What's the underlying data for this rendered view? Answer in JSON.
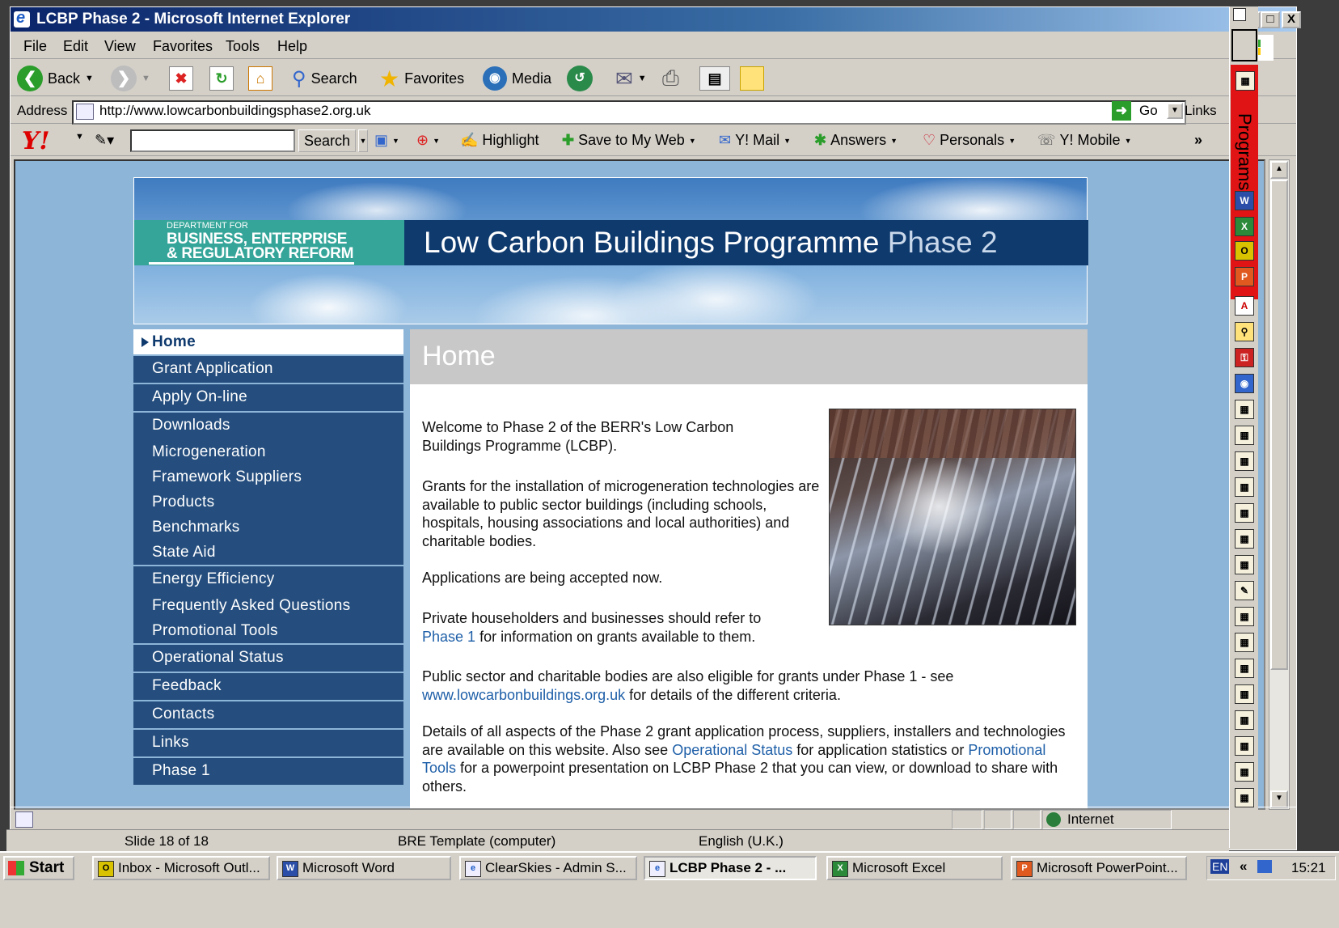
{
  "window": {
    "title": "LCBP Phase 2 - Microsoft Internet Explorer",
    "controls": [
      "_",
      "□",
      "X"
    ]
  },
  "menubar": [
    "File",
    "Edit",
    "View",
    "Favorites",
    "Tools",
    "Help"
  ],
  "toolbar": {
    "back": "Back",
    "search": "Search",
    "favorites": "Favorites",
    "media": "Media"
  },
  "address": {
    "label": "Address",
    "url": "http://www.lowcarbonbuildingsphase2.org.uk",
    "go": "Go",
    "links": "Links"
  },
  "yahoo": {
    "search_button": "Search",
    "highlight": "Highlight",
    "save": "Save to My Web",
    "mail": "Y! Mail",
    "answers": "Answers",
    "personals": "Personals",
    "mobile": "Y! Mobile",
    "more": "»"
  },
  "page": {
    "dept_line1": "DEPARTMENT FOR",
    "dept_line2": "BUSINESS, ENTERPRISE",
    "dept_line3": "& REGULATORY REFORM",
    "title_main": "Low Carbon Buildings Programme",
    "title_phase": "Phase 2",
    "heading": "Home",
    "nav": [
      {
        "label": "Home",
        "active": true
      },
      {
        "label": "Grant Application"
      },
      {
        "label": "Apply On-line"
      },
      {
        "label": "Downloads"
      },
      {
        "label": "Microgeneration"
      },
      {
        "label": "Framework Suppliers"
      },
      {
        "label": "Products"
      },
      {
        "label": "Benchmarks"
      },
      {
        "label": "State Aid"
      },
      {
        "label": "Energy Efficiency"
      },
      {
        "label": "Frequently Asked Questions"
      },
      {
        "label": "Promotional Tools"
      },
      {
        "label": "Operational Status"
      },
      {
        "label": "Feedback"
      },
      {
        "label": "Contacts"
      },
      {
        "label": "Links"
      },
      {
        "label": "Phase 1"
      }
    ],
    "p1": "Welcome to Phase 2 of the BERR's Low Carbon Buildings Programme (LCBP).",
    "p2": "Grants for the installation of microgeneration technologies are available to public sector buildings (including schools, hospitals, housing associations and local authorities) and charitable bodies.",
    "p3": "Applications are being accepted now.",
    "p4_a": "Private householders and businesses should refer to",
    "p4_link": "Phase 1",
    "p4_b": " for information on grants available to them.",
    "p5_a": "Public sector and charitable bodies are also eligible for grants under Phase 1 - see",
    "p5_link": "www.lowcarbonbuildings.org.uk",
    "p5_b": " for details of the different criteria.",
    "p6_a": "Details of all aspects of the Phase 2 grant application process, suppliers, installers and technologies are available on this website. Also see ",
    "p6_link1": "Operational Status",
    "p6_b": " for application statistics or ",
    "p6_link2": "Promotional Tools",
    "p6_c": " for  a powerpoint presentation on LCBP Phase 2 that you can view, or download to share with others."
  },
  "statusbar": {
    "zone": "Internet"
  },
  "ppt_status": {
    "slide": "Slide 18 of 18",
    "template": "BRE Template (computer)",
    "language": "English (U.K.)"
  },
  "officebar": {
    "label": "Programs"
  },
  "taskbar": {
    "start": "Start",
    "tasks": [
      "Inbox - Microsoft Outl...",
      "Microsoft Word",
      "ClearSkies - Admin S...",
      "LCBP Phase 2 - ...",
      "Microsoft Excel",
      "Microsoft PowerPoint..."
    ],
    "lang": "EN",
    "clock": "15:21"
  },
  "colors": {
    "nav_bg": "#254e7e",
    "title_band": "#0f3a6e",
    "berr_teal": "#35a59a",
    "link": "#1e5fa8",
    "page_bg": "#8db5d8"
  }
}
